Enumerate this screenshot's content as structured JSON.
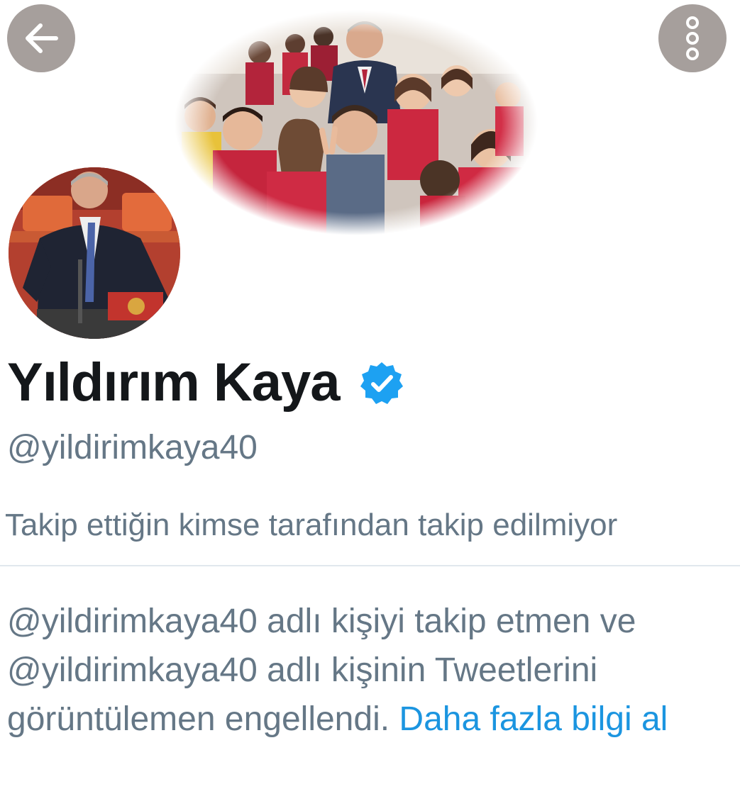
{
  "header": {
    "back_icon": "arrow-left-icon",
    "more_icon": "more-vertical-icon",
    "button_bg_color": "#a69f9c"
  },
  "profile": {
    "display_name": "Yıldırım Kaya",
    "verified_icon": "verified-badge-icon",
    "verified_color": "#1da1f2",
    "handle": "@yildirimkaya40",
    "follow_context": "Takip ettiğin kimse tarafından takip edilmiyor"
  },
  "blocked_notice": {
    "line1": "@yildirimkaya40 adlı kişiyi takip etmen ve",
    "line2": "@yildirimkaya40 adlı kişinin Tweetlerini",
    "line3": "görüntülemen engellendi. ",
    "link_text": "Daha fazla bilgi al",
    "link_color": "#1b95e0"
  }
}
